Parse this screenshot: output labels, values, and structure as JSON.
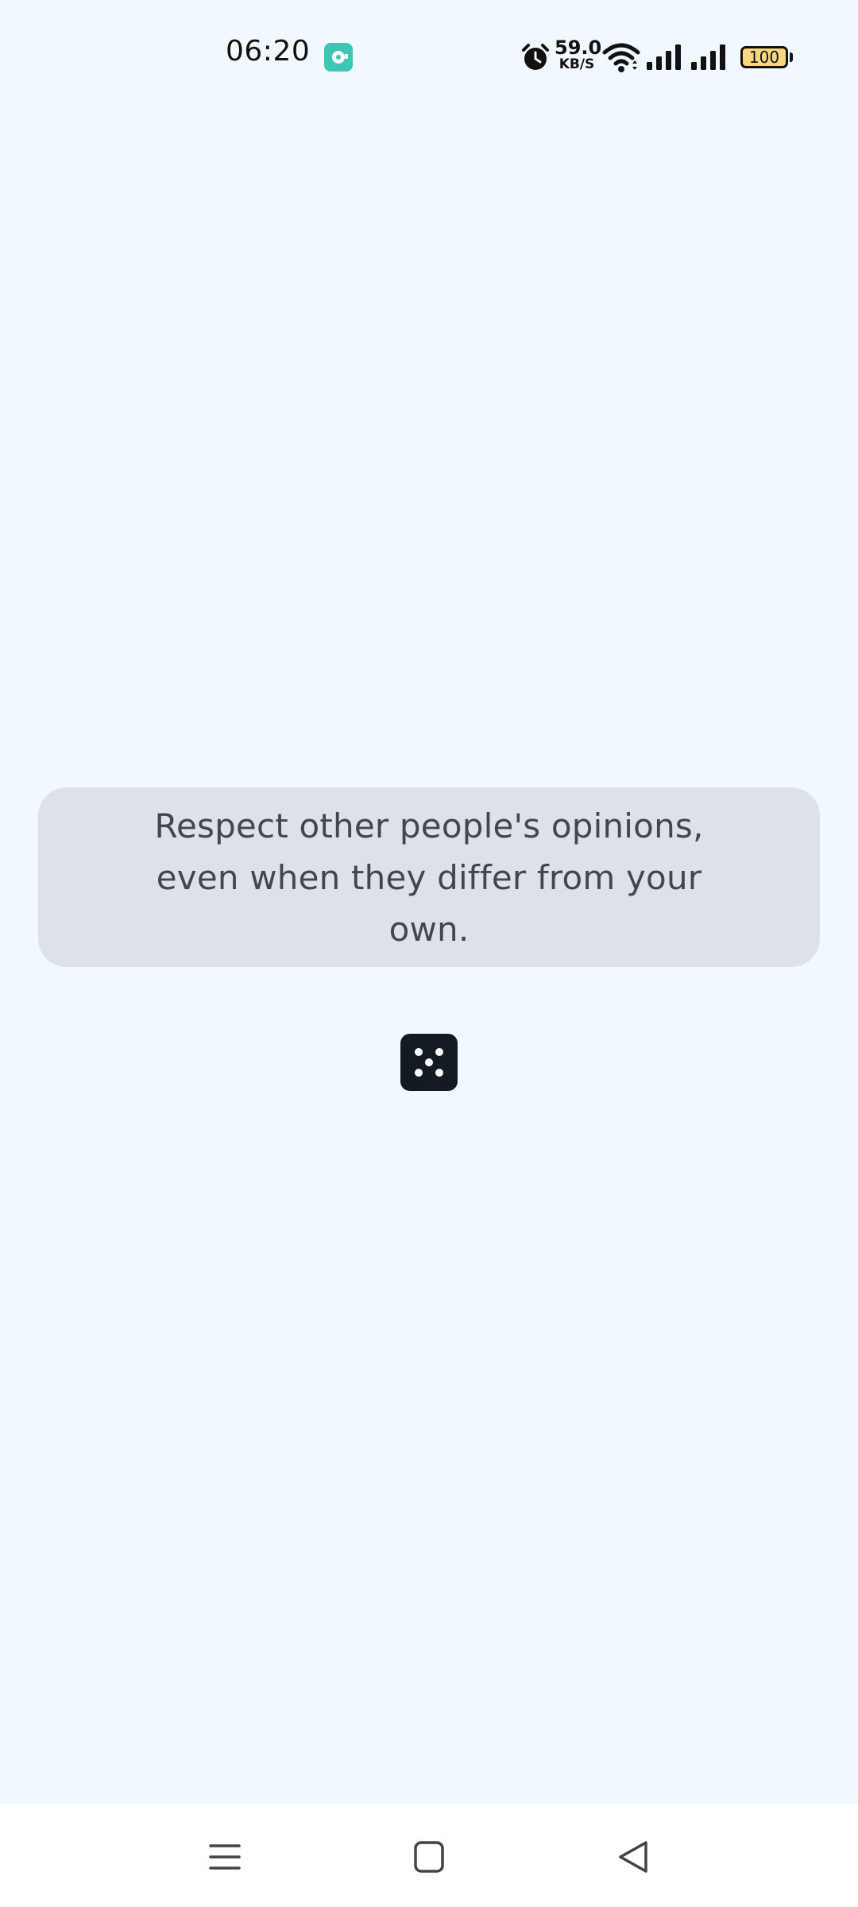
{
  "status_bar": {
    "time": "06:20",
    "net_speed_value": "59.0",
    "net_speed_unit": "KB/S",
    "battery_level": "100",
    "icons": [
      "app-notification-icon",
      "alarm-icon",
      "wifi-icon",
      "signal-icon",
      "signal-icon",
      "battery-icon"
    ]
  },
  "quote": {
    "text": "Respect other people's opinions, even when they differ from your own."
  },
  "actions": {
    "random_icon": "dice-icon"
  },
  "nav_bar": {
    "icons": [
      "menu-icon",
      "home-icon",
      "back-icon"
    ]
  },
  "colors": {
    "background": "#f1f8fe",
    "card": "#dde2e8",
    "quote_text": "#43474c",
    "dice_button": "#141b20",
    "app_icon": "#3cc6b3",
    "battery_fill": "#f9d77e"
  }
}
